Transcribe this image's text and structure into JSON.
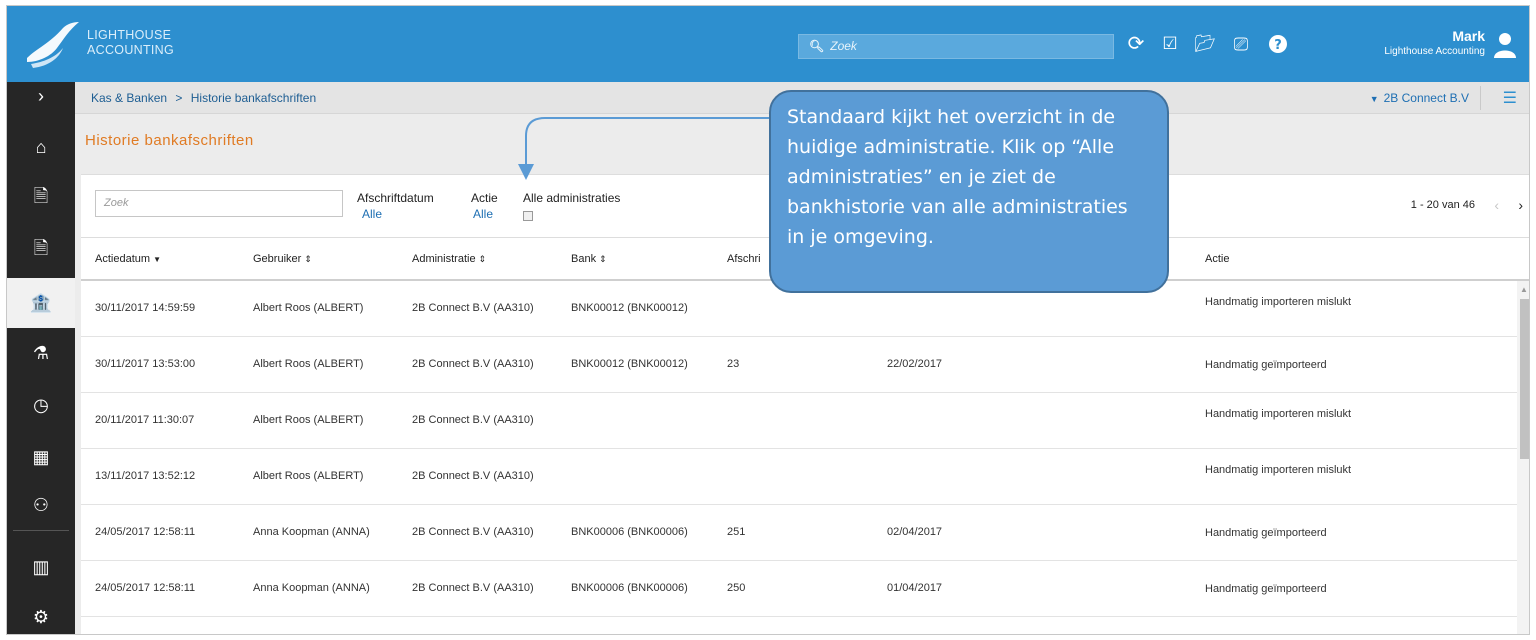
{
  "brand": {
    "line1": "LIGHTHOUSE",
    "line2": "ACCOUNTING"
  },
  "search": {
    "placeholder": "Zoek"
  },
  "user": {
    "name": "Mark",
    "org": "Lighthouse Accounting"
  },
  "breadcrumb": {
    "parent": "Kas & Banken",
    "separator": ">",
    "current": "Historie bankafschriften"
  },
  "admin_select": {
    "label": "2B Connect B.V"
  },
  "page": {
    "title": "Historie bankafschriften"
  },
  "filters": {
    "search_placeholder": "Zoek",
    "afschriftdatum": {
      "label": "Afschriftdatum",
      "value": "Alle"
    },
    "actie": {
      "label": "Actie",
      "value": "Alle"
    },
    "alle_administraties": {
      "label": "Alle administraties",
      "checked": false
    }
  },
  "pagination": {
    "text": "1 - 20 van 46"
  },
  "table": {
    "columns": [
      "Actiedatum",
      "Gebruiker",
      "Administratie",
      "Bank",
      "Afschri",
      "Actie"
    ],
    "rows": [
      {
        "date": "30/11/2017 14:59:59",
        "user": "Albert Roos (ALBERT)",
        "admin": "2B Connect B.V (AA310)",
        "bank": "BNK00012 (BNK00012)",
        "nr": "",
        "afdate": "",
        "action": "Handmatig importeren mislukt"
      },
      {
        "date": "30/11/2017 13:53:00",
        "user": "Albert Roos (ALBERT)",
        "admin": "2B Connect B.V (AA310)",
        "bank": "BNK00012 (BNK00012)",
        "nr": "23",
        "afdate": "22/02/2017",
        "action": "Handmatig geïmporteerd"
      },
      {
        "date": "20/11/2017 11:30:07",
        "user": "Albert Roos (ALBERT)",
        "admin": "2B Connect B.V (AA310)",
        "bank": "",
        "nr": "",
        "afdate": "",
        "action": "Handmatig importeren mislukt"
      },
      {
        "date": "13/11/2017 13:52:12",
        "user": "Albert Roos (ALBERT)",
        "admin": "2B Connect B.V (AA310)",
        "bank": "",
        "nr": "",
        "afdate": "",
        "action": "Handmatig importeren mislukt"
      },
      {
        "date": "24/05/2017 12:58:11",
        "user": "Anna Koopman (ANNA)",
        "admin": "2B Connect B.V (AA310)",
        "bank": "BNK00006 (BNK00006)",
        "nr": "251",
        "afdate": "02/04/2017",
        "action": "Handmatig geïmporteerd"
      },
      {
        "date": "24/05/2017 12:58:11",
        "user": "Anna Koopman (ANNA)",
        "admin": "2B Connect B.V (AA310)",
        "bank": "BNK00006 (BNK00006)",
        "nr": "250",
        "afdate": "01/04/2017",
        "action": "Handmatig geïmporteerd"
      }
    ]
  },
  "callout": {
    "text": "Standaard kijkt het overzicht in de huidige administratie. Klik op “Alle administraties” en je ziet de bankhistorie van alle administraties in je omgeving."
  },
  "sidebar": {
    "items": [
      "expand-icon",
      "home-icon",
      "document-out-icon",
      "document-in-icon",
      "bank-icon",
      "flask-icon",
      "clock-user-icon",
      "buildings-icon",
      "users-icon",
      "report-icon",
      "settings-icon"
    ]
  },
  "colors": {
    "topbar": "#2d8fcf",
    "sidebar": "#262626",
    "title": "#e07b24",
    "link": "#1e6fb3",
    "callout": "#5b9bd5"
  }
}
